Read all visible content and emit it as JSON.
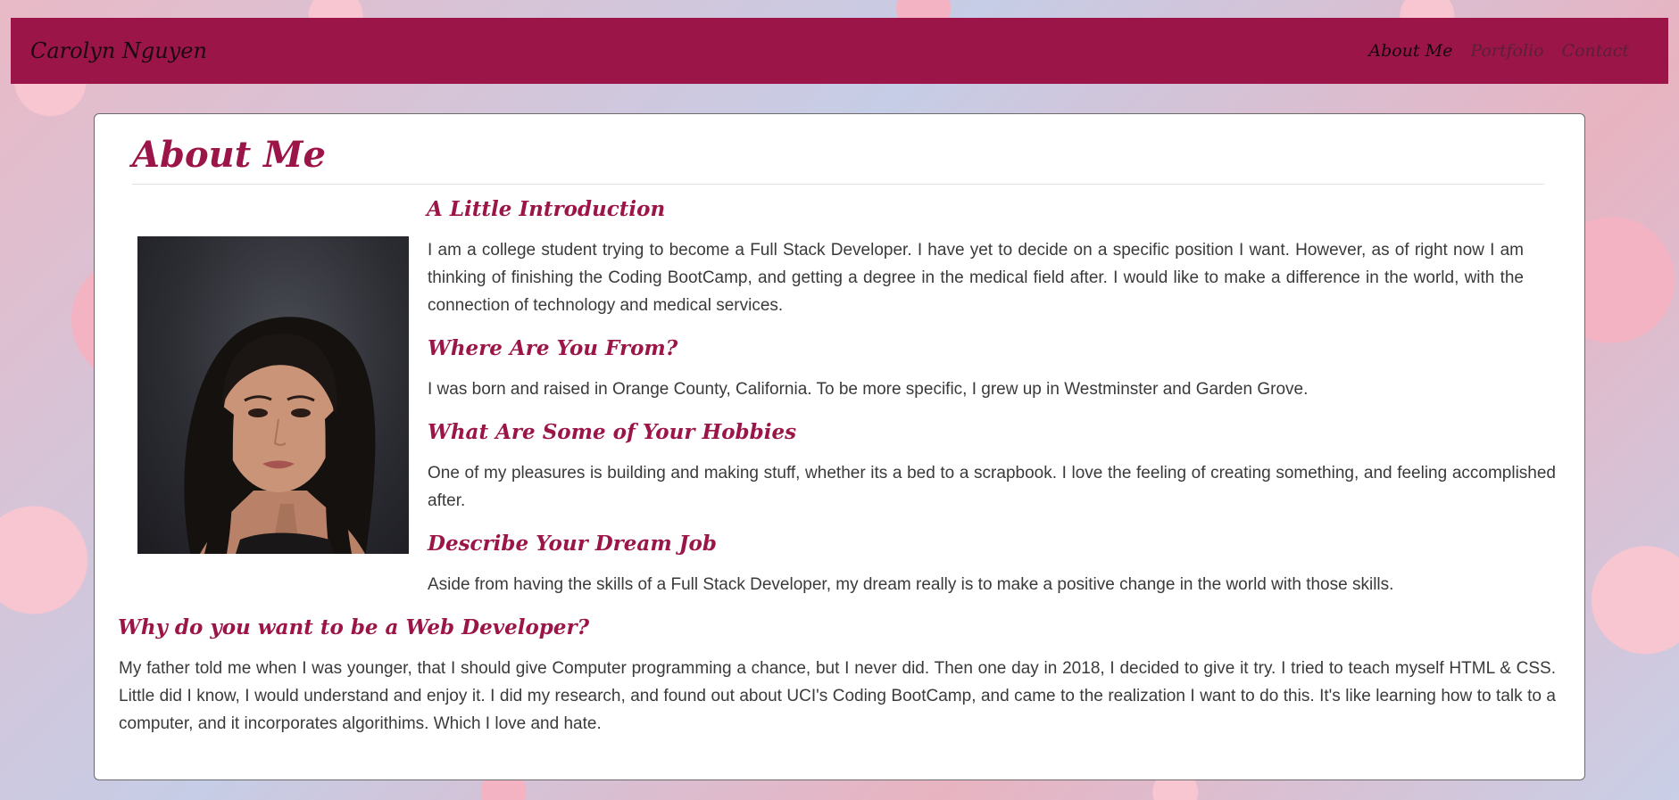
{
  "navbar": {
    "brand": "Carolyn Nguyen",
    "links": [
      {
        "label": "About Me"
      },
      {
        "label": "Portfolio"
      },
      {
        "label": "Contact"
      }
    ]
  },
  "colors": {
    "brand_primary": "#9b1548",
    "card_background": "#ffffff",
    "body_text": "#3a3a3a"
  },
  "main": {
    "title": "About Me",
    "portrait_alt": "Portrait of Carolyn Nguyen",
    "sections": [
      {
        "heading": "A Little Introduction",
        "text": "I am a college student trying to become a Full Stack Developer. I have yet to decide on a specific position I want. However, as of right now I am thinking of finishing the Coding BootCamp, and getting a degree in the medical field after. I would like to make a difference in the world, with the connection of technology and medical services."
      },
      {
        "heading": "Where Are You From?",
        "text": "I was born and raised in Orange County, California. To be more specific, I grew up in Westminster and Garden Grove."
      },
      {
        "heading": "What Are Some of Your Hobbies",
        "text": "One of my pleasures is building and making stuff, whether its a bed to a scrapbook. I love the feeling of creating something, and feeling accomplished after."
      },
      {
        "heading": "Describe Your Dream Job",
        "text": "Aside from having the skills of a Full Stack Developer, my dream really is to make a positive change in the world with those skills."
      },
      {
        "heading": "Why do you want to be a Web Developer?",
        "text": "My father told me when I was younger, that I should give Computer programming a chance, but I never did. Then one day in 2018, I decided to give it try. I tried to teach myself HTML & CSS. Little did I know, I would understand and enjoy it. I did my research, and found out about UCI's Coding BootCamp, and came to the realization I want to do this. It's like learning how to talk to a computer, and it incorporates algorithims. Which I love and hate."
      }
    ]
  }
}
